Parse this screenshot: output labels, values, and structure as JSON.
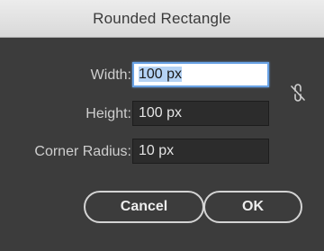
{
  "window": {
    "title": "Rounded Rectangle"
  },
  "form": {
    "width": {
      "label": "Width:",
      "value": "100 px"
    },
    "height": {
      "label": "Height:",
      "value": "100 px"
    },
    "corner_radius": {
      "label": "Corner Radius:",
      "value": "10 px"
    },
    "constrain_icon": "unlink-chain-icon"
  },
  "buttons": {
    "cancel_label": "Cancel",
    "ok_label": "OK"
  },
  "colors": {
    "dialog_background": "#3c3c3c",
    "titlebar_background": "#e3e3e3",
    "focus_ring": "#6aa3e6",
    "selection": "#b5d3f5"
  }
}
